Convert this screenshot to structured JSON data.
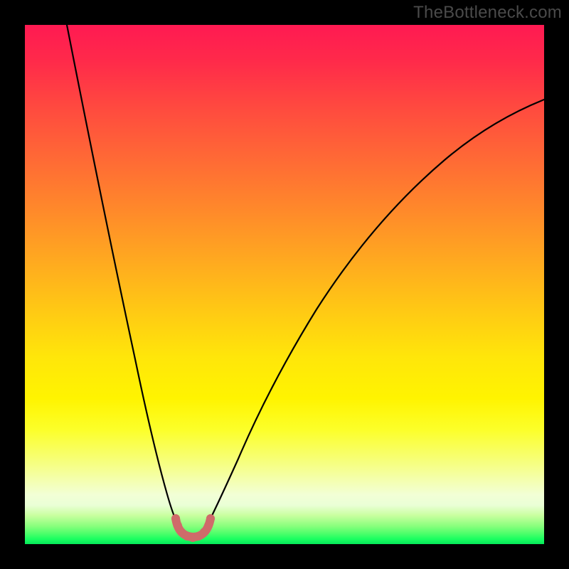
{
  "watermark": "TheBottleneck.com",
  "chart_data": {
    "type": "line",
    "title": "",
    "xlabel": "",
    "ylabel": "",
    "xlim": [
      0,
      100
    ],
    "ylim": [
      0,
      100
    ],
    "grid": false,
    "legend": false,
    "background": "vertical-heat-gradient",
    "series": [
      {
        "name": "bottleneck-curve",
        "x": [
          8,
          12,
          17,
          22,
          26,
          29,
          30,
          31,
          32.3,
          33.5,
          35.4,
          38,
          43,
          50,
          60,
          72,
          85,
          100
        ],
        "values": [
          100,
          75,
          52,
          30,
          13,
          4.5,
          2,
          1,
          1,
          2,
          4.5,
          12,
          26,
          42,
          58,
          72,
          82,
          86
        ],
        "color": "#000000",
        "stroke_width": 2.2
      },
      {
        "name": "optimal-zone-highlight",
        "x": [
          29,
          29.6,
          30.5,
          31.5,
          32.3,
          33.1,
          34,
          35,
          35.7
        ],
        "values": [
          5,
          3.3,
          2,
          1.3,
          1.2,
          1.3,
          2,
          3.3,
          5
        ],
        "color": "#cf6b6a",
        "stroke_width": 12,
        "marker": "round-beads"
      }
    ],
    "annotations": [
      {
        "text": "TheBottleneck.com",
        "position": "top-right",
        "role": "watermark",
        "color": "#4a4a4a"
      }
    ],
    "gradient_stops": [
      {
        "pct": 0,
        "color": "#ff1a52"
      },
      {
        "pct": 26,
        "color": "#ff6a35"
      },
      {
        "pct": 55,
        "color": "#ffc914"
      },
      {
        "pct": 78,
        "color": "#fcff2a"
      },
      {
        "pct": 90,
        "color": "#f2ffd6"
      },
      {
        "pct": 100,
        "color": "#05e859"
      }
    ]
  }
}
